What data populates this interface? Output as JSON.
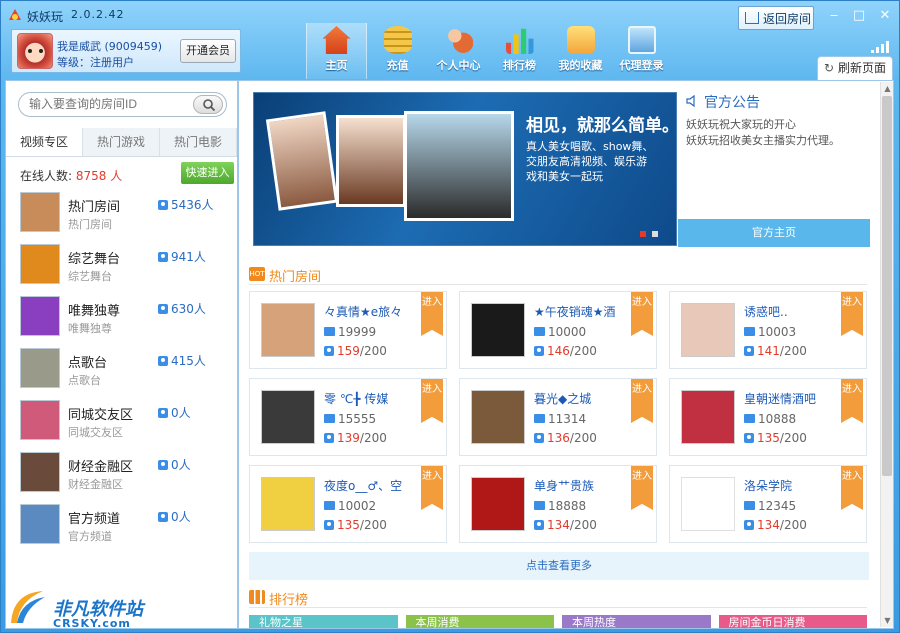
{
  "window": {
    "title": "妖妖玩",
    "version": "2.0.2.42",
    "back_label": "返回房间",
    "refresh_label": "刷新页面"
  },
  "user": {
    "name": "我是威武 (9009459)",
    "level": "等级：注册用户",
    "vip_label": "开通会员"
  },
  "nav": [
    {
      "label": "主页",
      "icon": "home-icon",
      "color": "#e35a2a"
    },
    {
      "label": "充值",
      "icon": "coins-icon",
      "color": "#e6b422"
    },
    {
      "label": "个人中心",
      "icon": "user-center-icon",
      "color": "#d95b28"
    },
    {
      "label": "排行榜",
      "icon": "rank-chart-icon",
      "color": "#3a9be2"
    },
    {
      "label": "我的收藏",
      "icon": "favorite-heart-icon",
      "color": "#e8532f"
    },
    {
      "label": "代理登录",
      "icon": "agent-monitor-icon",
      "color": "#4a8fd6"
    }
  ],
  "left": {
    "search_placeholder": "输入要查询的房间ID",
    "tabs": [
      "视频专区",
      "热门游戏",
      "热门电影"
    ],
    "online_label": "在线人数:",
    "online_count": "8758 人",
    "quick_label": "快速进入",
    "rooms": [
      {
        "name": "热门房间",
        "sub": "热门房间",
        "count": "5436人",
        "color": "#c88b5a"
      },
      {
        "name": "综艺舞台",
        "sub": "综艺舞台",
        "count": "941人",
        "color": "#e08a1e"
      },
      {
        "name": "唯舞独尊",
        "sub": "唯舞独尊",
        "count": "630人",
        "color": "#8a3fc0"
      },
      {
        "name": "点歌台",
        "sub": "点歌台",
        "count": "415人",
        "color": "#9a9a8a"
      },
      {
        "name": "同城交友区",
        "sub": "同城交友区",
        "count": "0人",
        "color": "#d05a7a"
      },
      {
        "name": "财经金融区",
        "sub": "财经金融区",
        "count": "0人",
        "color": "#6a4a3a"
      },
      {
        "name": "官方频道",
        "sub": "官方频道",
        "count": "0人",
        "color": "#5a8ac0"
      }
    ]
  },
  "banner": {
    "title": "相见，就那么简单。",
    "lines": [
      "真人美女唱歌、show舞、",
      "交朋友高清视频、娱乐游",
      "戏和美女一起玩"
    ]
  },
  "notice": {
    "title": "官方公告",
    "lines": [
      "妖妖玩祝大家玩的开心",
      "妖妖玩招收美女主播实力代理。"
    ],
    "button": "官方主页"
  },
  "hot_section": {
    "title": "热门房间",
    "badge": "HOT"
  },
  "cards": [
    {
      "name": "々真情★e旅々",
      "id": "19999",
      "current": "159",
      "max": "/200",
      "color": "#d6a27a",
      "tag": "进入"
    },
    {
      "name": "★午夜销魂★酒",
      "id": "10000",
      "current": "146",
      "max": "/200",
      "color": "#1a1a1a",
      "tag": "进入"
    },
    {
      "name": "诱惑吧..",
      "id": "10003",
      "current": "141",
      "max": "/200",
      "color": "#e8c8b8",
      "tag": "进入"
    },
    {
      "name": "零 ℃╊ 传媒",
      "id": "15555",
      "current": "139",
      "max": "/200",
      "color": "#3a3a3a",
      "tag": "进入"
    },
    {
      "name": "暮光◆之城",
      "id": "11314",
      "current": "136",
      "max": "/200",
      "color": "#7a5a3a",
      "tag": "进入"
    },
    {
      "name": "皇朝迷情酒吧",
      "id": "10888",
      "current": "135",
      "max": "/200",
      "color": "#c03040",
      "tag": "进入"
    },
    {
      "name": "夜度o__♂、空",
      "id": "10002",
      "current": "135",
      "max": "/200",
      "color": "#f0d040",
      "tag": "进入"
    },
    {
      "name": "单身艹贵族",
      "id": "18888",
      "current": "134",
      "max": "/200",
      "color": "#b01818",
      "tag": "进入"
    },
    {
      "name": "洛朵学院",
      "id": "12345",
      "current": "134",
      "max": "/200",
      "color": "#ffffff",
      "tag": "进入"
    }
  ],
  "more_label": "点击查看更多",
  "rank_section": {
    "title": "排行榜"
  },
  "rank_tabs": [
    {
      "label": "礼物之星",
      "color": "#5bc4c8"
    },
    {
      "label": "本周消费",
      "color": "#8bc34a"
    },
    {
      "label": "本周热度",
      "color": "#9a7ac8"
    },
    {
      "label": "房间金币日消费",
      "color": "#e85a8a"
    }
  ],
  "watermark": {
    "text": "非凡软件站",
    "sub": "CRSKY.com"
  }
}
